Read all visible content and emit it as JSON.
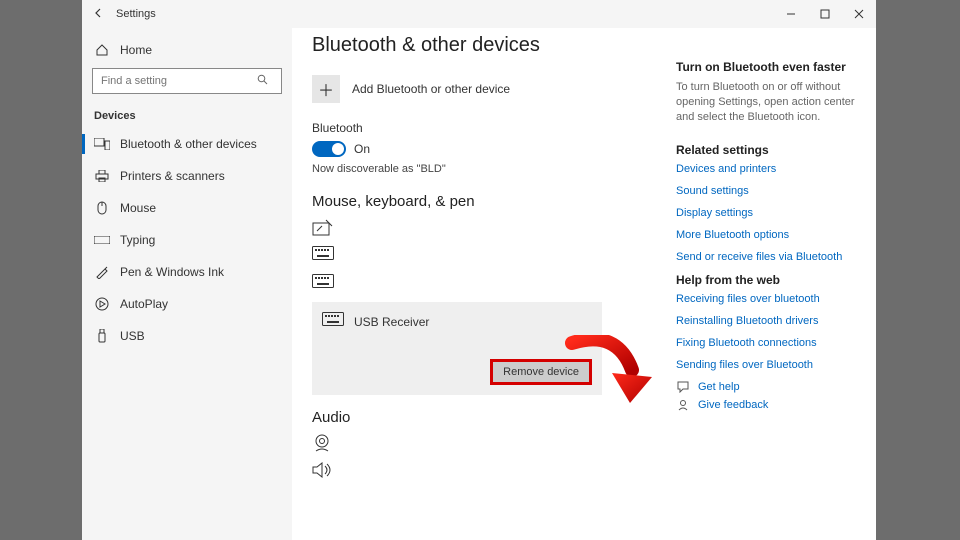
{
  "titlebar": {
    "title": "Settings"
  },
  "sidebar": {
    "home": "Home",
    "searchPlaceholder": "Find a setting",
    "section": "Devices",
    "items": [
      {
        "label": "Bluetooth & other devices"
      },
      {
        "label": "Printers & scanners"
      },
      {
        "label": "Mouse"
      },
      {
        "label": "Typing"
      },
      {
        "label": "Pen & Windows Ink"
      },
      {
        "label": "AutoPlay"
      },
      {
        "label": "USB"
      }
    ]
  },
  "main": {
    "heading": "Bluetooth & other devices",
    "addLabel": "Add Bluetooth or other device",
    "btLabel": "Bluetooth",
    "btState": "On",
    "discoverable": "Now discoverable as \"BLD\"",
    "sectionMouseKbd": "Mouse, keyboard, & pen",
    "selectedDevice": "USB Receiver",
    "removeBtn": "Remove device",
    "sectionAudio": "Audio"
  },
  "aside": {
    "tip": {
      "title": "Turn on Bluetooth even faster",
      "body": "To turn Bluetooth on or off without opening Settings, open action center and select the Bluetooth icon."
    },
    "related": {
      "title": "Related settings",
      "links": [
        "Devices and printers",
        "Sound settings",
        "Display settings",
        "More Bluetooth options",
        "Send or receive files via Bluetooth"
      ]
    },
    "helpWeb": {
      "title": "Help from the web",
      "links": [
        "Receiving files over bluetooth",
        "Reinstalling Bluetooth drivers",
        "Fixing Bluetooth connections",
        "Sending files over Bluetooth"
      ]
    },
    "getHelp": "Get help",
    "feedback": "Give feedback"
  }
}
